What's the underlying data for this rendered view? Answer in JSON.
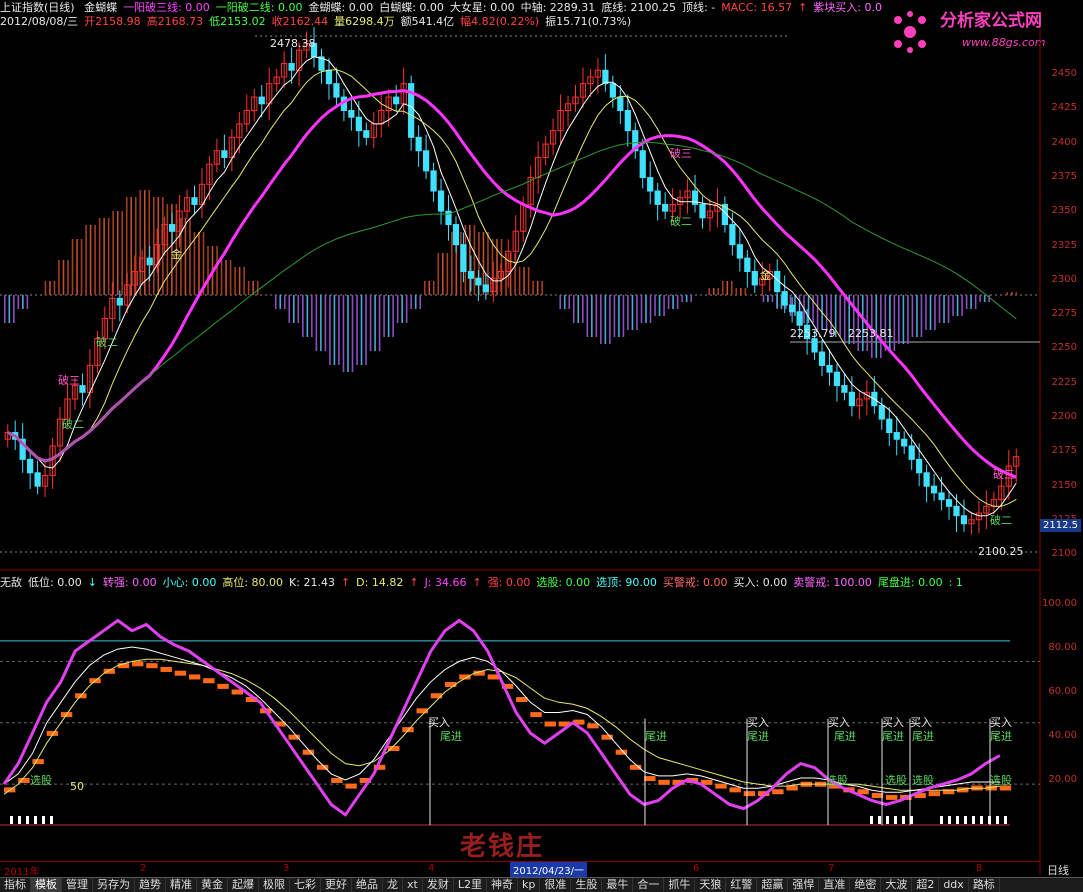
{
  "info_line1": {
    "index_name": "上证指数(日线)",
    "items": [
      {
        "text": "金蝴蝶",
        "color": "#e8e8e8"
      },
      {
        "text": "一阳破三线: 0.00",
        "color": "#ff44ff"
      },
      {
        "text": "一阳破二线: 0.00",
        "color": "#44ff44"
      },
      {
        "text": "金蝴蝶: 0.00",
        "color": "#e8e8e8"
      },
      {
        "text": "白蝴蝶: 0.00",
        "color": "#e8e8e8"
      },
      {
        "text": "大女星: 0.00",
        "color": "#e8e8e8"
      },
      {
        "text": "中轴: 2289.31",
        "color": "#e8e8e8"
      },
      {
        "text": "底线: 2100.25",
        "color": "#e8e8e8"
      },
      {
        "text": "顶线: -",
        "color": "#e8e8e8"
      },
      {
        "text": "MACC: 16.57",
        "color": "#ff4444"
      },
      {
        "text": "↑",
        "color": "#ff4444"
      },
      {
        "text": "紫块买入: 0.0",
        "color": "#ff66ff"
      }
    ]
  },
  "info_line2": {
    "items": [
      {
        "text": "2012/08/08/三",
        "color": "#e8e8e8"
      },
      {
        "text": "开2158.98",
        "color": "#ff4444"
      },
      {
        "text": "高2168.73",
        "color": "#ff4444"
      },
      {
        "text": "低2153.02",
        "color": "#44ff44"
      },
      {
        "text": "收2162.44",
        "color": "#ff4444"
      },
      {
        "text": "量6298.4万",
        "color": "#e8e870"
      },
      {
        "text": "额541.4亿",
        "color": "#e8e8e8"
      },
      {
        "text": "幅4.82(0.22%)",
        "color": "#ff4444"
      },
      {
        "text": "振15.71(0.73%)",
        "color": "#e8e8e8"
      }
    ]
  },
  "sub_line": {
    "items": [
      {
        "text": "无敌",
        "color": "#e8e8e8"
      },
      {
        "text": "低位: 0.00",
        "color": "#e8e8e8"
      },
      {
        "text": "↓",
        "color": "#44ffff"
      },
      {
        "text": "转强: 0.00",
        "color": "#ff66ff"
      },
      {
        "text": "小心: 0.00",
        "color": "#44ffff"
      },
      {
        "text": "高位: 80.00",
        "color": "#e8e870"
      },
      {
        "text": "K: 21.43",
        "color": "#e8e8e8"
      },
      {
        "text": "↑",
        "color": "#ff4444"
      },
      {
        "text": "D: 14.82",
        "color": "#e8e870"
      },
      {
        "text": "↑",
        "color": "#ff4444"
      },
      {
        "text": "J: 34.66",
        "color": "#ff44ff"
      },
      {
        "text": "↑",
        "color": "#ff4444"
      },
      {
        "text": "强: 0.00",
        "color": "#ff4444"
      },
      {
        "text": "选股: 0.00",
        "color": "#44ff44"
      },
      {
        "text": "选顶: 90.00",
        "color": "#44ffff"
      },
      {
        "text": "买警戒: 0.00",
        "color": "#ff6666"
      },
      {
        "text": "买入: 0.00",
        "color": "#e8e8e8"
      },
      {
        "text": "卖警戒: 100.00",
        "color": "#ff66ff"
      },
      {
        "text": "尾盘进: 0.00",
        "color": "#44ff44"
      },
      {
        "text": ": 1",
        "color": "#44ff44"
      }
    ]
  },
  "main_y_ticks": [
    "2450",
    "2425",
    "2400",
    "2375",
    "2350",
    "2325",
    "2300",
    "2275",
    "2250",
    "2225",
    "2200",
    "2175",
    "2150",
    "2125",
    "2100"
  ],
  "sub_y_ticks": [
    "100.00",
    "80.00",
    "60.00",
    "40.00",
    "20.00"
  ],
  "price_tag": "2112.5",
  "annotations": {
    "high": "2478.38",
    "low": "2100.25",
    "level": "2253.79",
    "level2": "2253.81",
    "po3": "破三",
    "po2": "破二",
    "jin": "金",
    "mai_ru": "买入",
    "wei_jin": "尾进",
    "xuan_gu": "选股",
    "val_50": "50"
  },
  "date_axis": {
    "labels": [
      "2011年",
      "2",
      "3",
      "4",
      "5",
      "6",
      "7",
      "8"
    ],
    "cursor": "2012/04/23/一",
    "period": "日线"
  },
  "tabs": [
    "指标",
    "模板",
    "管理",
    "另存为",
    "趋势",
    "精准",
    "黄金",
    "起爆",
    "极限",
    "七彩",
    "更好",
    "绝品",
    "龙",
    "xt",
    "发财",
    "L2里",
    "神奇",
    "kp",
    "很准",
    "生股",
    "最牛",
    "合一",
    "抓牛",
    "天狼",
    "红警",
    "超赢",
    "强悍",
    "直准",
    "绝密",
    "大波",
    "超2",
    "ddx",
    "路标"
  ],
  "active_tab": "模板",
  "logo": {
    "title": "分析家公式网",
    "url": "www.88gs.com"
  },
  "watermark": "老钱庄",
  "colors": {
    "up": "#ff3030",
    "down": "#40e0ff",
    "ma_fast": "#ffffff",
    "ma_mid": "#e8e870",
    "ma_purple": "#ff33ff",
    "ma_slow": "#2e9a2e"
  },
  "chart_data": {
    "type": "candlestick",
    "ylim": [
      2085,
      2480
    ],
    "closes": [
      2180,
      2175,
      2160,
      2150,
      2140,
      2148,
      2170,
      2190,
      2205,
      2215,
      2210,
      2230,
      2250,
      2265,
      2280,
      2275,
      2290,
      2300,
      2310,
      2305,
      2320,
      2335,
      2330,
      2345,
      2355,
      2350,
      2365,
      2380,
      2390,
      2385,
      2400,
      2410,
      2420,
      2430,
      2425,
      2440,
      2445,
      2455,
      2450,
      2465,
      2470,
      2460,
      2450,
      2440,
      2430,
      2420,
      2415,
      2405,
      2400,
      2410,
      2420,
      2430,
      2425,
      2440,
      2400,
      2390,
      2375,
      2360,
      2345,
      2335,
      2320,
      2300,
      2295,
      2290,
      2285,
      2295,
      2300,
      2315,
      2330,
      2350,
      2370,
      2385,
      2395,
      2405,
      2420,
      2425,
      2430,
      2440,
      2445,
      2450,
      2440,
      2430,
      2420,
      2405,
      2390,
      2370,
      2360,
      2350,
      2345,
      2350,
      2355,
      2360,
      2350,
      2340,
      2345,
      2350,
      2335,
      2320,
      2310,
      2300,
      2290,
      2295,
      2300,
      2285,
      2275,
      2270,
      2260,
      2250,
      2240,
      2230,
      2225,
      2215,
      2210,
      2200,
      2205,
      2210,
      2200,
      2190,
      2180,
      2175,
      2170,
      2160,
      2150,
      2140,
      2135,
      2130,
      2125,
      2118,
      2112,
      2115,
      2120,
      2125,
      2130,
      2140,
      2155,
      2162
    ],
    "macd": [
      -0.2,
      -0.1,
      0.0,
      0.1,
      0.25,
      0.4,
      0.5,
      0.55,
      0.6,
      0.7,
      0.75,
      0.7,
      0.65,
      0.55,
      0.45,
      0.35,
      0.25,
      0.2,
      0.1,
      0.0,
      -0.1,
      -0.2,
      -0.3,
      -0.4,
      -0.5,
      -0.55,
      -0.5,
      -0.4,
      -0.3,
      -0.2,
      -0.1,
      0.1,
      0.3,
      0.45,
      0.5,
      0.45,
      0.4,
      0.3,
      0.2,
      0.1,
      0.0,
      -0.1,
      -0.2,
      -0.3,
      -0.35,
      -0.3,
      -0.25,
      -0.2,
      -0.15,
      -0.1,
      -0.05,
      0.0,
      0.05,
      0.1,
      0.05,
      0.0,
      -0.05,
      -0.1,
      -0.15,
      -0.2,
      -0.25,
      -0.3,
      -0.35,
      -0.4,
      -0.45,
      -0.4,
      -0.35,
      -0.3,
      -0.25,
      -0.2,
      -0.15,
      -0.1,
      -0.05,
      0.0,
      0.02
    ],
    "kdj_j": [
      20,
      30,
      45,
      60,
      70,
      85,
      90,
      95,
      100,
      95,
      98,
      92,
      88,
      85,
      80,
      75,
      70,
      65,
      60,
      50,
      40,
      30,
      20,
      10,
      5,
      15,
      25,
      40,
      55,
      70,
      85,
      95,
      100,
      95,
      85,
      70,
      55,
      45,
      40,
      45,
      50,
      45,
      35,
      25,
      15,
      10,
      12,
      18,
      22,
      20,
      15,
      10,
      8,
      12,
      18,
      25,
      30,
      28,
      22,
      18,
      15,
      12,
      10,
      12,
      15,
      18,
      20,
      22,
      25,
      30,
      34
    ],
    "kdj_k": [
      20,
      25,
      35,
      50,
      60,
      70,
      78,
      83,
      86,
      87,
      86,
      84,
      82,
      80,
      78,
      75,
      72,
      68,
      62,
      55,
      48,
      40,
      32,
      25,
      22,
      25,
      32,
      42,
      52,
      62,
      70,
      76,
      80,
      82,
      80,
      75,
      68,
      60,
      55,
      55,
      56,
      54,
      48,
      40,
      32,
      26,
      24,
      24,
      25,
      24,
      22,
      20,
      18,
      18,
      19,
      21,
      23,
      23,
      22,
      20,
      19,
      17,
      16,
      16,
      17,
      18,
      19,
      20,
      21,
      21,
      21
    ],
    "kdj_d": [
      15,
      20,
      28,
      40,
      50,
      60,
      68,
      74,
      78,
      80,
      81,
      81,
      80,
      79,
      78,
      76,
      74,
      71,
      67,
      62,
      56,
      49,
      42,
      35,
      30,
      29,
      31,
      36,
      43,
      51,
      58,
      65,
      70,
      74,
      76,
      75,
      72,
      67,
      62,
      60,
      59,
      57,
      53,
      48,
      42,
      37,
      33,
      31,
      29,
      27,
      25,
      23,
      21,
      20,
      19,
      19,
      20,
      20,
      20,
      20,
      20,
      19,
      18,
      17,
      17,
      17,
      17,
      17,
      18,
      18,
      19
    ]
  }
}
